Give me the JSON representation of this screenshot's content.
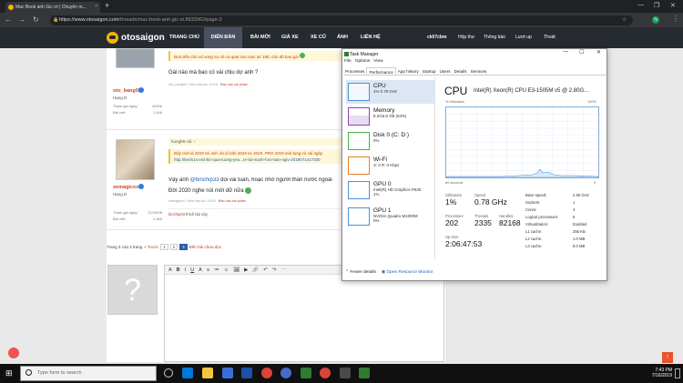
{
  "browser": {
    "tab_title": "Mac Book anh Gic ơi | Chuyên m...",
    "url_host": "https://www.otosaigon.com",
    "url_path": "/threads/mac-book-anh-gic-oi.8933962/page-3",
    "profile_initial": "N"
  },
  "site": {
    "logo": "otosaigon",
    "nav": [
      "TRANG CHỦ",
      "DIỄN ĐÀN",
      "BÀI MỚI",
      "GIÁ XE",
      "XE CŨ",
      "ẢNH",
      "LIÊN HỆ"
    ],
    "user_menu": [
      "ck07cbm",
      "Hộp thư",
      "Thông báo",
      "Lượt up",
      "Thoát"
    ]
  },
  "posts": [
    {
      "username": "oto_bang02",
      "rank": "Hạng D",
      "stats": [
        {
          "label": "Tham gia ngày:",
          "value": "4/9/06"
        },
        {
          "label": "Bài viết:",
          "value": "1.448"
        }
      ],
      "quote": "Đưa tiền cho nó xong sợ nó ca quẹt con mac air 18tr, còn đủ bao gái",
      "message": "Gái nào mà bao có vài chịu dợ anh ?",
      "meta_user": "oto_bang02,",
      "meta_time": "Hôm nay lúc 19:15",
      "meta_report": "Báo cáo sai phạm"
    },
    {
      "username": "xemagicxx",
      "rank": "Hạng D",
      "stats": [
        {
          "label": "Tham gia ngày:",
          "value": "21/10/08"
        },
        {
          "label": "Bài viết:",
          "value": "2.465"
        }
      ],
      "quote_head": "hungh8 nói: ↑",
      "quote": "Đây mới là 2019 nè anh. ko là bản 2019 ex 2019. PRO 2019 mới tung có vài ngày",
      "quote_link": "http://kenh14.vn/nhin-qua-tuong-yeu...re-lai-manh-hon-ban-ngiv-2019071417200",
      "message_pre": "Vậy anh",
      "mention": "@binchip33",
      "message_post": "đọi vài tuần, hoặc nhờ người thân nước ngoài",
      "message_line2": "Đời 2020 nghe nói mới dữ nữa",
      "meta_user": "xemagicxx,",
      "meta_time": "Hôm nay lúc 19:20",
      "meta_report": "Báo cáo sai phạm",
      "likes_name": "binchip33",
      "likes_text": "thích bài này."
    }
  ],
  "pager": {
    "label": "Trang 3 của 3 trang",
    "prev": "« Trước",
    "pages": [
      "1",
      "2",
      "3"
    ],
    "jump": "Đến bài chưa đọc"
  },
  "editor": {
    "toolbar": [
      "A",
      "B",
      "I",
      "U",
      "A",
      "≡",
      "≔",
      "☺",
      "🖼",
      "▶",
      "🔗",
      "↶",
      "↷",
      "⋯"
    ]
  },
  "task_manager": {
    "title": "Task Manager",
    "menu": [
      "File",
      "Options",
      "View"
    ],
    "tabs": [
      "Processes",
      "Performance",
      "App history",
      "Startup",
      "Users",
      "Details",
      "Services"
    ],
    "resources": [
      {
        "name": "CPU",
        "detail": "1% 0.78 GHz",
        "color": "#4a90d9"
      },
      {
        "name": "Memory",
        "detail": "8.3/15.8 GB (53%)",
        "color": "#8e44ad"
      },
      {
        "name": "Disk 0 (C: D:)",
        "detail": "0%",
        "color": "#4caf50"
      },
      {
        "name": "Wi-Fi",
        "detail": "S: 0 R: 0 Kbps",
        "color": "#e67e22"
      },
      {
        "name": "GPU 0",
        "detail": "Intel(R) HD Graphics P530",
        "detail2": "1%",
        "color": "#4a90d9"
      },
      {
        "name": "GPU 1",
        "detail": "NVIDIA Quadro M1000M",
        "detail2": "0%",
        "color": "#4a90d9"
      }
    ],
    "cpu_heading": "CPU",
    "cpu_model": "Intel(R) Xeon(R) CPU E3-1505M v5 @ 2.80G...",
    "graph_label": "% Utilization",
    "graph_max": "100%",
    "graph_time": "60 seconds",
    "graph_min": "0",
    "stats": [
      {
        "label": "Utilization",
        "value": "1%"
      },
      {
        "label": "Speed",
        "value": "0.78 GHz"
      },
      {
        "label": "Processes",
        "value": "202"
      },
      {
        "label": "Threads",
        "value": "2335"
      },
      {
        "label": "Handles",
        "value": "82168"
      },
      {
        "label": "Up time",
        "value": "2:06:47:53"
      }
    ],
    "details": [
      {
        "k": "Base speed:",
        "v": "2.80 GHz"
      },
      {
        "k": "Sockets:",
        "v": "1"
      },
      {
        "k": "Cores:",
        "v": "4"
      },
      {
        "k": "Logical processors:",
        "v": "8"
      },
      {
        "k": "Virtualization:",
        "v": "Enabled"
      },
      {
        "k": "L1 cache:",
        "v": "256 KB"
      },
      {
        "k": "L2 cache:",
        "v": "1.0 MB"
      },
      {
        "k": "L3 cache:",
        "v": "8.0 MB"
      }
    ],
    "fewer": "Fewer details",
    "open_rm": "Open Resource Monitor"
  },
  "taskbar": {
    "search": "Type here to search",
    "time": "7:43 PM",
    "date": "7/16/2019"
  }
}
